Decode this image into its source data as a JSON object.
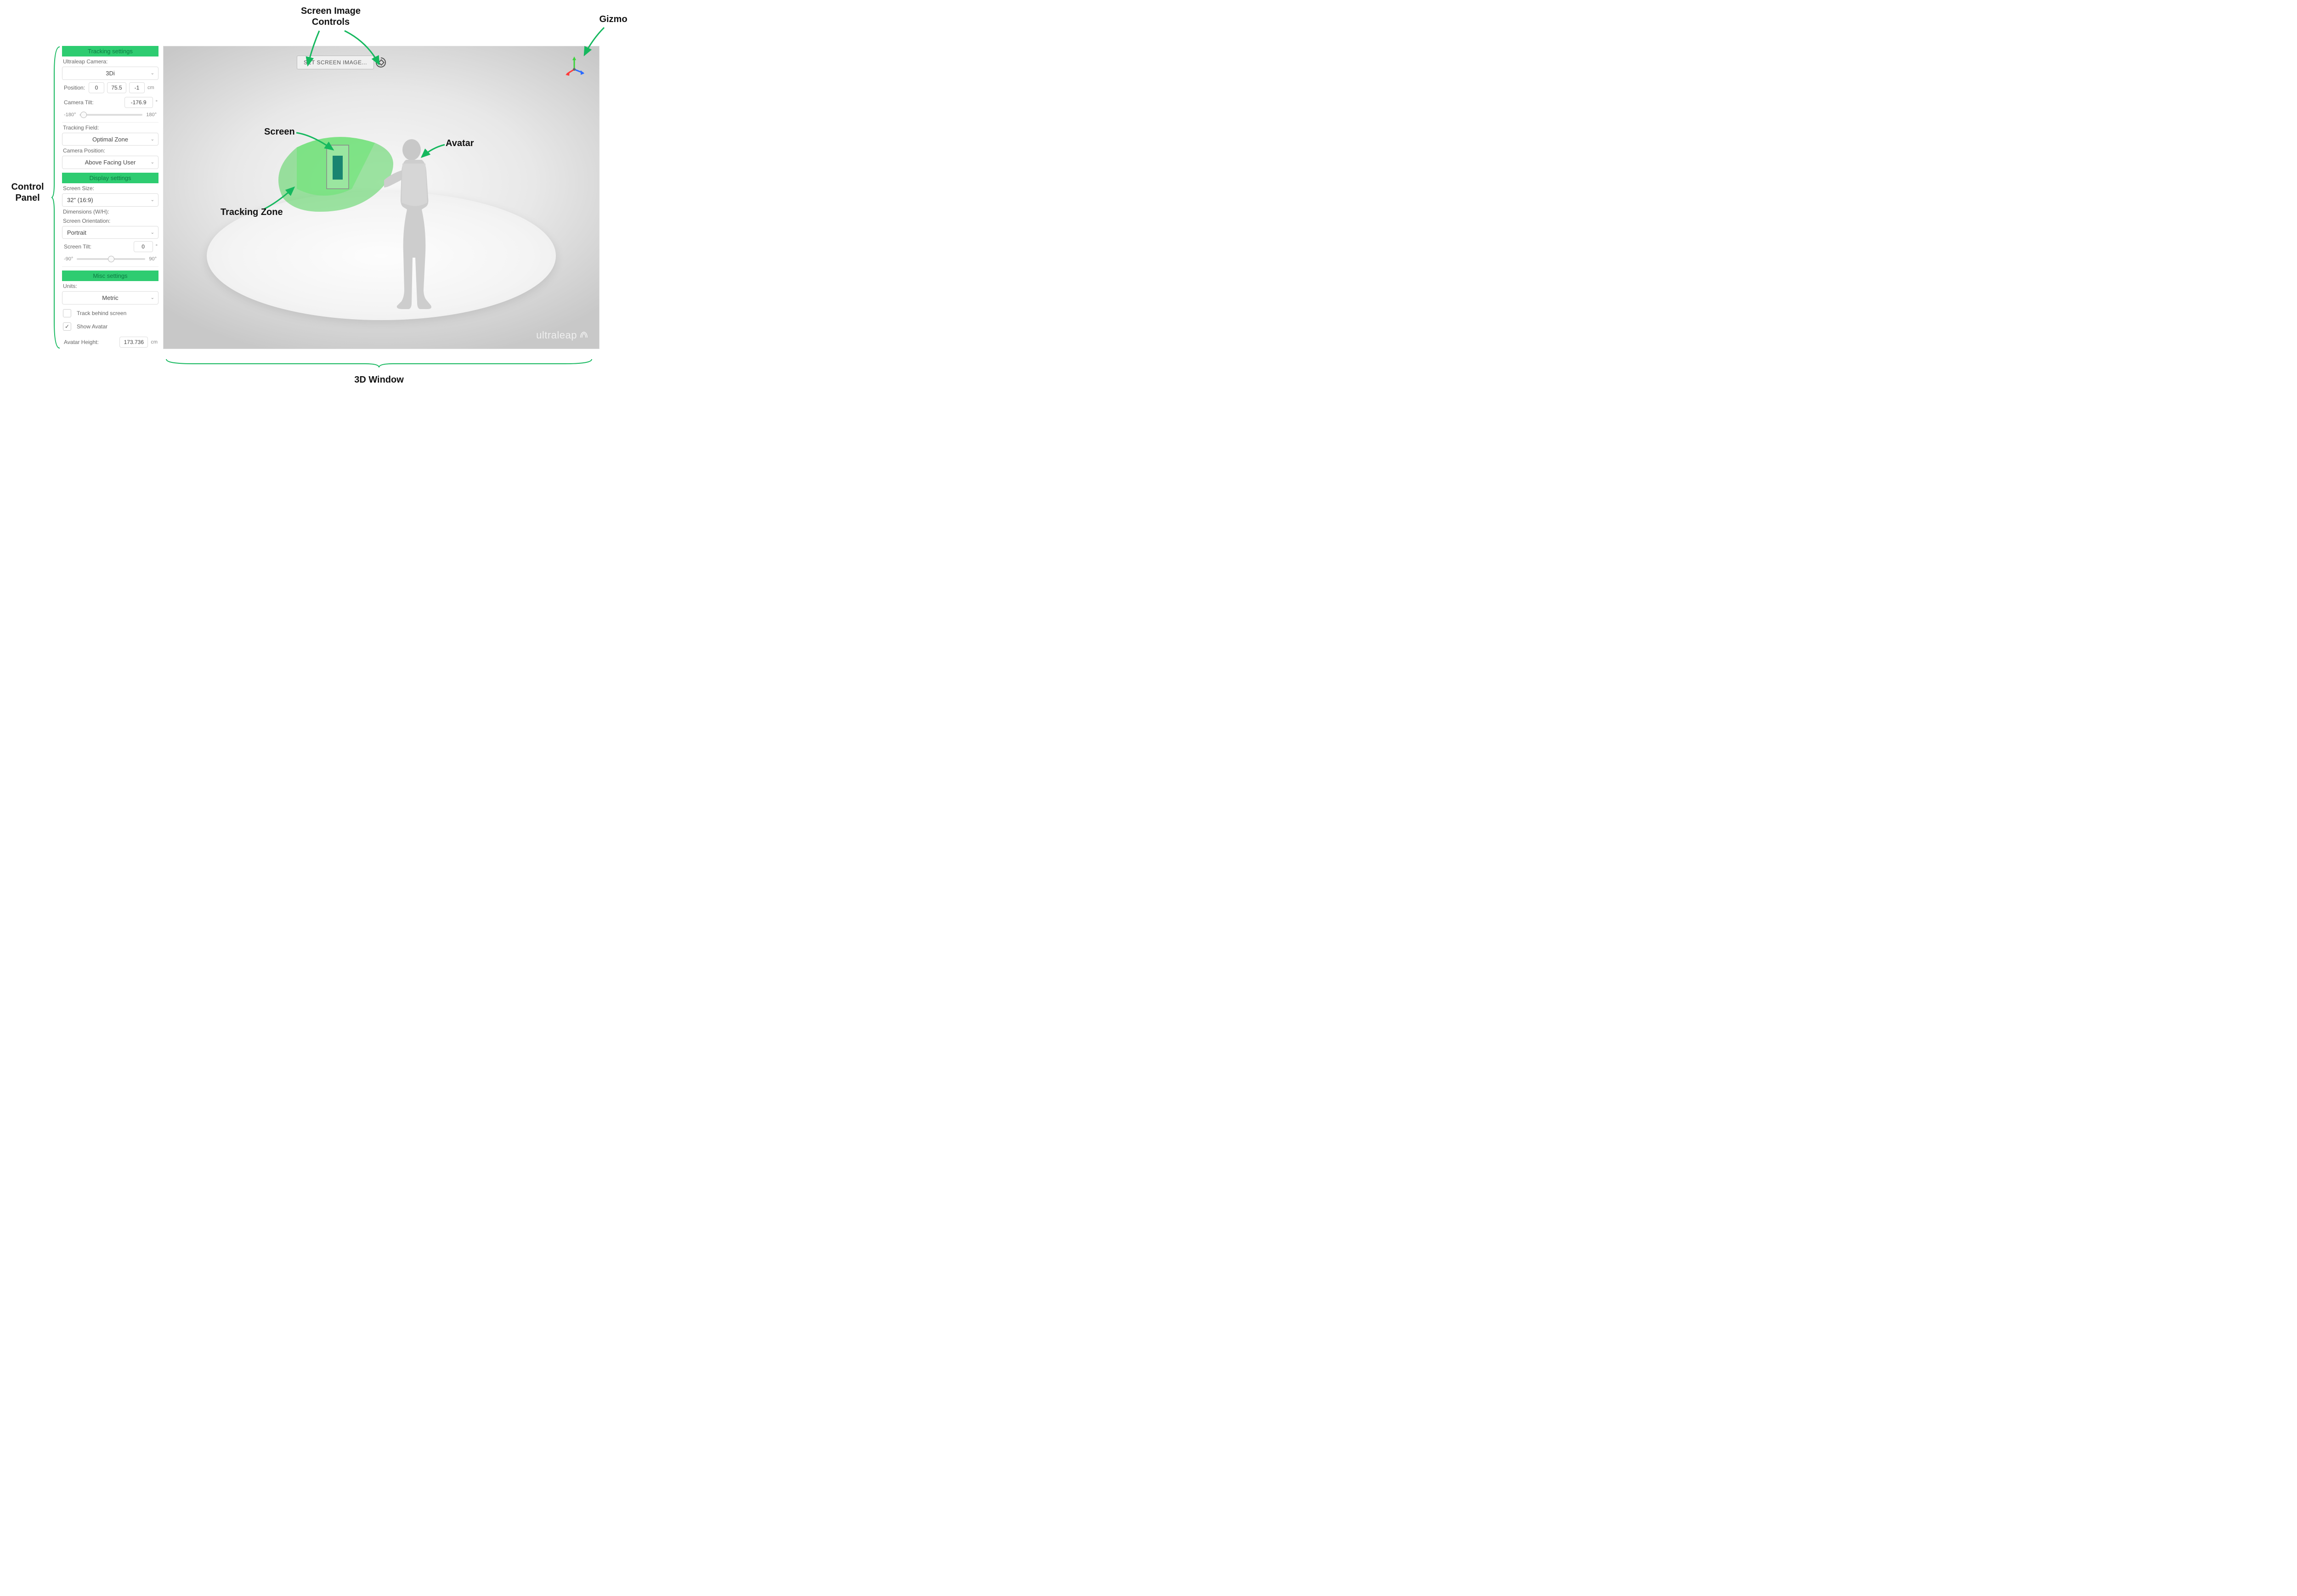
{
  "annotations": {
    "screen_image_controls": "Screen Image\nControls",
    "gizmo": "Gizmo",
    "control_panel": "Control\nPanel",
    "screen": "Screen",
    "avatar": "Avatar",
    "tracking_zone": "Tracking Zone",
    "window_3d": "3D Window"
  },
  "control_panel": {
    "tracking": {
      "header": "Tracking settings",
      "camera_label": "Ultraleap Camera:",
      "camera_value": "3Di",
      "position_label": "Position:",
      "position_x": "0",
      "position_y": "75.5",
      "position_z": "-1",
      "position_unit": "cm",
      "tilt_label": "Camera Tilt:",
      "tilt_value": "-176.9",
      "tilt_unit": "°",
      "slider_min": "-180°",
      "slider_max": "180°",
      "field_label": "Tracking Field:",
      "field_value": "Optimal Zone",
      "cam_pos_label": "Camera Position:",
      "cam_pos_value": "Above Facing User"
    },
    "display": {
      "header": "Display settings",
      "size_label": "Screen Size:",
      "size_value": "32\" (16:9)",
      "dimensions_label": "Dimensions (W/H):",
      "orientation_label": "Screen Orientation:",
      "orientation_value": "Portrait",
      "tilt_label": "Screen Tilt:",
      "tilt_value": "0",
      "tilt_unit": "°",
      "slider_min": "-90°",
      "slider_max": "90°"
    },
    "misc": {
      "header": "Misc settings",
      "units_label": "Units:",
      "units_value": "Metric",
      "track_behind_label": "Track behind screen",
      "show_avatar_label": "Show Avatar",
      "avatar_height_label": "Avatar Height:",
      "avatar_height_value": "173.736",
      "avatar_height_unit": "cm",
      "check": "✓"
    }
  },
  "viewport": {
    "set_screen_button": "SET SCREEN IMAGE...",
    "logo": "ultraleap"
  }
}
